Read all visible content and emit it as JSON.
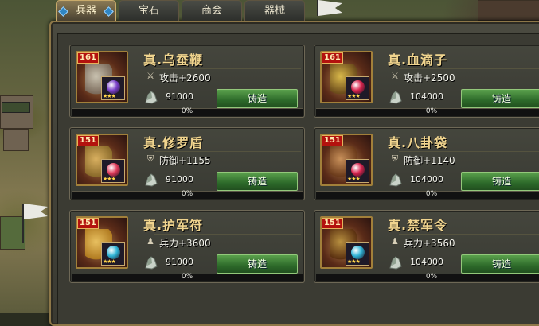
{
  "tabs": [
    {
      "label": "兵器",
      "active": true
    },
    {
      "label": "宝石",
      "active": false
    },
    {
      "label": "商会",
      "active": false
    },
    {
      "label": "器械",
      "active": false
    }
  ],
  "cards": [
    {
      "level": "161",
      "name": "真.乌蚕鞭",
      "stat_icon": "sword-icon",
      "stat": "攻击+2600",
      "cost": "91000",
      "button": "铸造",
      "progress": "0%",
      "progress_value": 0,
      "gem_color": "#7a3fc9",
      "stars": "★★★"
    },
    {
      "level": "161",
      "name": "真.血滴子",
      "stat_icon": "sword-icon",
      "stat": "攻击+2500",
      "cost": "104000",
      "button": "铸造",
      "progress": "0%",
      "progress_value": 0,
      "gem_color": "#d8244d",
      "stars": "★★★"
    },
    {
      "level": "151",
      "name": "真.修罗盾",
      "stat_icon": "shield-icon",
      "stat": "防御+1155",
      "cost": "91000",
      "button": "铸造",
      "progress": "0%",
      "progress_value": 0,
      "gem_color": "#e03a5a",
      "stars": "★★★"
    },
    {
      "level": "151",
      "name": "真.八卦袋",
      "stat_icon": "shield-icon",
      "stat": "防御+1140",
      "cost": "104000",
      "button": "铸造",
      "progress": "0%",
      "progress_value": 0,
      "gem_color": "#d8244d",
      "stars": "★★★"
    },
    {
      "level": "151",
      "name": "真.护军符",
      "stat_icon": "soldier-icon",
      "stat": "兵力+3600",
      "cost": "91000",
      "button": "铸造",
      "progress": "0%",
      "progress_value": 0,
      "gem_color": "#2fb3d6",
      "stars": "★★★"
    },
    {
      "level": "151",
      "name": "真.禁军令",
      "stat_icon": "soldier-icon",
      "stat": "兵力+3560",
      "cost": "104000",
      "button": "铸造",
      "progress": "0%",
      "progress_value": 0,
      "gem_color": "#2fb3d6",
      "stars": "★★★"
    }
  ]
}
